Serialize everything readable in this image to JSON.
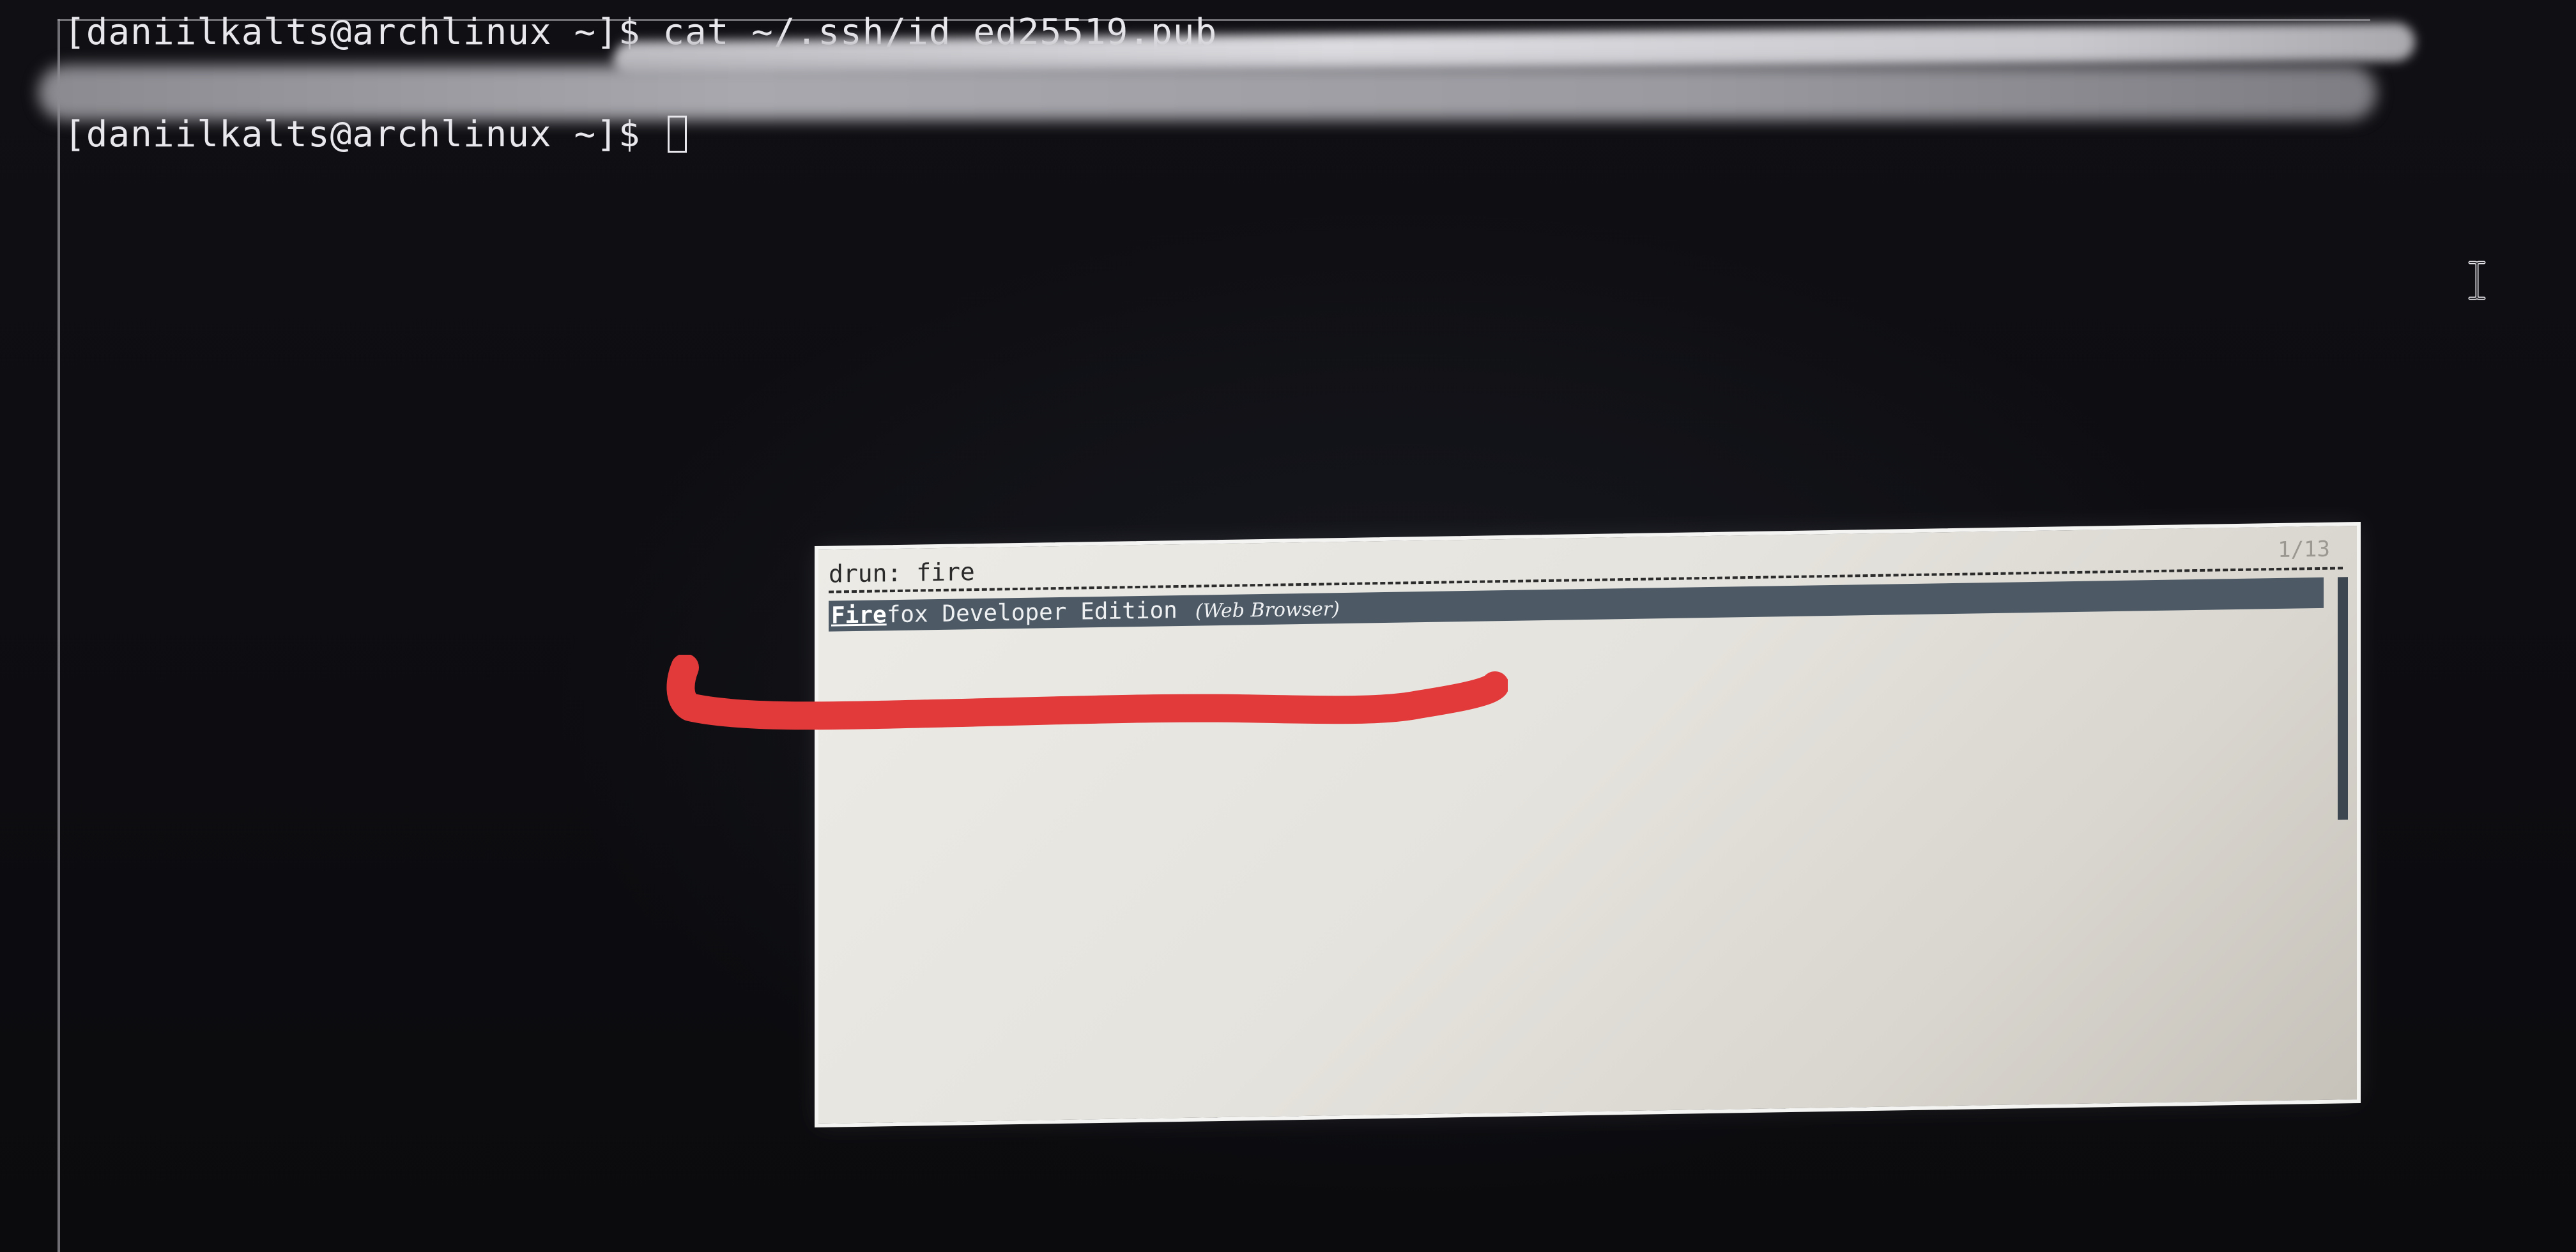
{
  "terminal": {
    "line1": {
      "prompt": "[daniilkalts@archlinux ~]$ ",
      "command": "cat ~/.ssh/id_ed25519.pub"
    },
    "line3": {
      "prompt": "[daniilkalts@archlinux ~]$ "
    }
  },
  "launcher": {
    "mode_label": "drun:",
    "query": "fire",
    "counter": "1/13",
    "entries": [
      {
        "match": "Fire",
        "rest": "fox Developer Edition",
        "generic_name": "(Web Browser)",
        "selected": true
      }
    ],
    "selection_color": "#4d5a66"
  },
  "icons": {
    "mouse_cursor": "ibeam-cursor-icon",
    "text_cursor": "block-cursor"
  },
  "colors": {
    "terminal_bg": "#0c0c10",
    "terminal_fg": "#e8e8ec",
    "launcher_bg": "#e5e3dd",
    "redaction_marker": "#e23a3a"
  }
}
